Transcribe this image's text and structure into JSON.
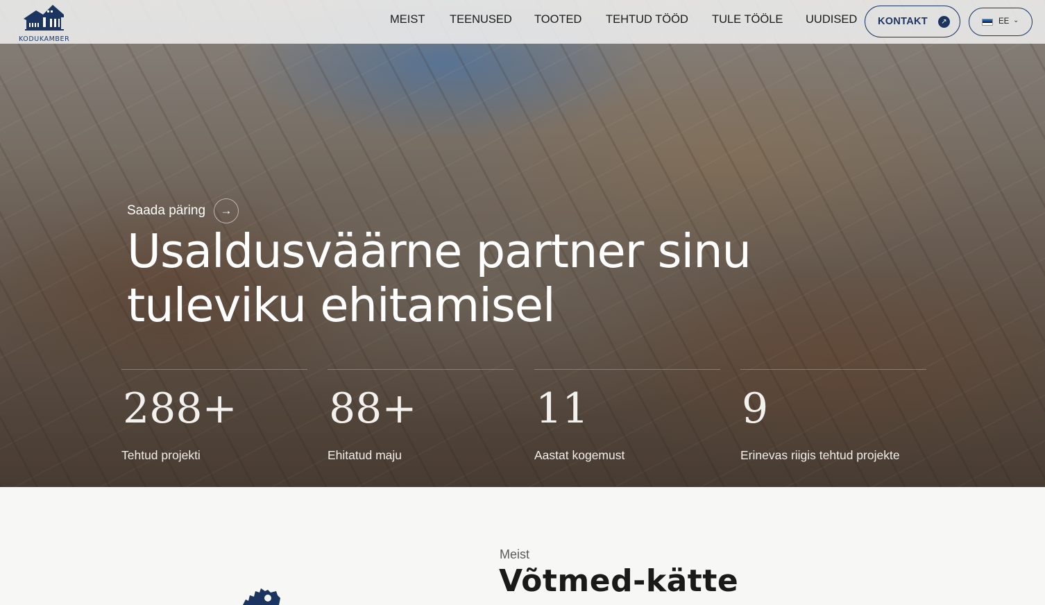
{
  "brand": {
    "name": "KODUKAMBER",
    "color": "#1b3560"
  },
  "nav": {
    "items": [
      {
        "label": "MEIST"
      },
      {
        "label": "TEENUSED"
      },
      {
        "label": "TOOTED"
      },
      {
        "label": "TEHTUD TÖÖD"
      },
      {
        "label": "TULE TÖÖLE"
      },
      {
        "label": "UUDISED"
      }
    ],
    "contact_button": "KONTAKT",
    "contact_icon": "arrow-up-right-icon",
    "language": {
      "code": "EE",
      "flag": "estonia-flag-icon"
    }
  },
  "hero": {
    "cta_label": "Saada päring",
    "cta_icon": "arrow-right-icon",
    "title_line1": "Usaldusväärne partner sinu",
    "title_line2": "tuleviku ehitamisel",
    "stats": [
      {
        "value": "288+",
        "label": "Tehtud projekti"
      },
      {
        "value": "88+",
        "label": "Ehitatud maju"
      },
      {
        "value": "11",
        "label": "Aastat kogemust"
      },
      {
        "value": "9",
        "label": "Erinevas riigis tehtud projekte"
      }
    ]
  },
  "about": {
    "eyebrow": "Meist",
    "title": "Võtmed-kätte"
  }
}
